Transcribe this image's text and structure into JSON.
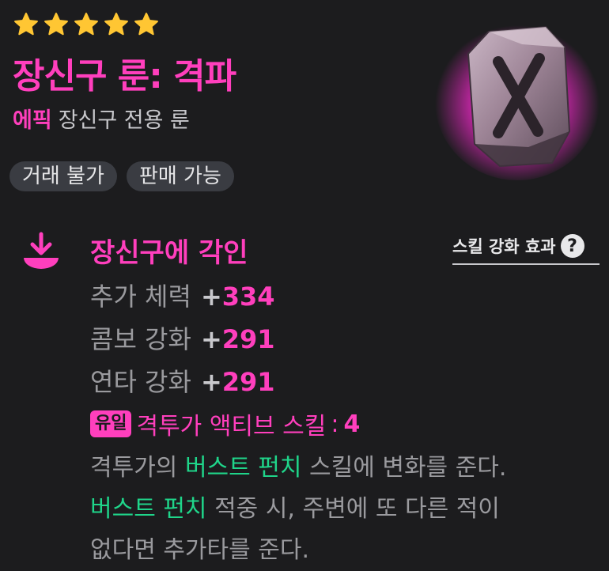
{
  "item": {
    "star_count": 5,
    "title": "장신구 룬: 격파",
    "rarity": "에픽",
    "type": "장신구 전용 룬",
    "tags": [
      "거래 불가",
      "판매 가능"
    ],
    "icon": "rune-x-icon"
  },
  "engrave": {
    "title": "장신구에 각인",
    "help_label": "스킬 강화 효과",
    "help_icon": "?",
    "stats": [
      {
        "label": "추가 체력",
        "plus": "+",
        "value": "334"
      },
      {
        "label": "콤보 강화",
        "plus": "+",
        "value": "291"
      },
      {
        "label": "연타 강화",
        "plus": "+",
        "value": "291"
      }
    ],
    "unique": {
      "badge": "유일",
      "label": "격투가 액티브 스킬",
      "colon": ":",
      "value": "4"
    },
    "description": {
      "l1a": "격투가의 ",
      "l1b": "버스트 펀치",
      "l1c": " 스킬에 변화를 준다.",
      "l2a": "버스트 펀치",
      "l2b": " 적중 시, 주변에 또 다른 적이",
      "l3": "없다면 추가타를 준다."
    }
  },
  "colors": {
    "accent": "#ff3fbd",
    "highlight": "#1fd58a",
    "star": "#ffc633",
    "background": "#1c1c1e"
  }
}
